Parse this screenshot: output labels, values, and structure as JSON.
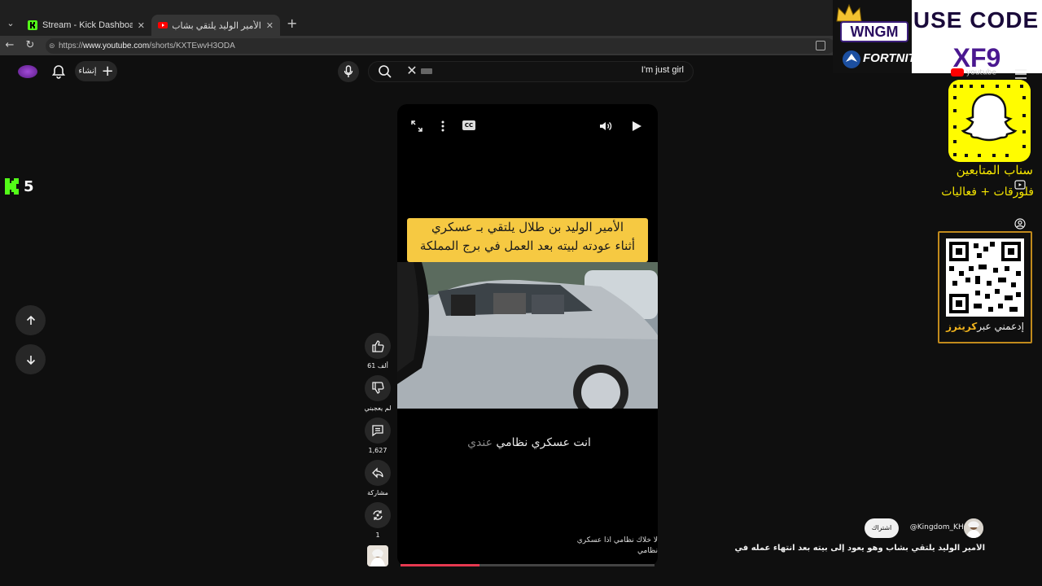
{
  "browser": {
    "tabs": [
      {
        "title": "Stream - Kick Dashboard",
        "favicon": "kick-icon",
        "favicon_color": "#53fc18"
      },
      {
        "title": "الأمير الوليد يلتقي بشاب وهو يعود إ",
        "favicon": "youtube-icon",
        "favicon_color": "#ff0000"
      }
    ],
    "url": {
      "prefix": "https://",
      "domain": "www.youtube.com",
      "path": "/shorts/KXTEwvH3ODA"
    }
  },
  "header": {
    "create_label": "إنشاء",
    "search_query": "I'm just girl"
  },
  "kick_overlay": {
    "count": "5",
    "color": "#53fc18"
  },
  "player": {
    "caption_line1": "الأمير الوليد بن طلال يلتقي بـ عسكري",
    "caption_line2": "أثناء عودته لبيته بعد العمل في برج المملكة",
    "subtitle_main": "انت عسكري نظامي ",
    "subtitle_dim": "عندي",
    "comment_snippet_line1": "لا خلاك نظامي اذا عسكري نظامي",
    "comment_snippet_line2": "ي",
    "progress": 0.31
  },
  "actions": {
    "likes": "61 ألف",
    "dislike_label": "لم يعجبني",
    "comments": "1,627",
    "share_label": "مشاركة",
    "remix_count": "1"
  },
  "promo": {
    "line1": "USE CODE",
    "code": "XF9",
    "wngm": "WNGM",
    "fortnite": "FORTNITE",
    "brand_color": "#4a1890"
  },
  "side_overlay": {
    "yt_mini": "youtube",
    "snap_title": "سناب المتابعين",
    "snap_sub": "فلورقات + فعاليات",
    "qr_text_main": "إدعمني عبر",
    "qr_text_highlight": "كريترز"
  },
  "channel": {
    "subscribe_label": "اشتراك",
    "handle": "@Kingdom_KHC",
    "video_title": "الأمير الوليد يلتقي بشاب وهو يعود إلى بيته بعد انتهاء عمله في بر..."
  }
}
